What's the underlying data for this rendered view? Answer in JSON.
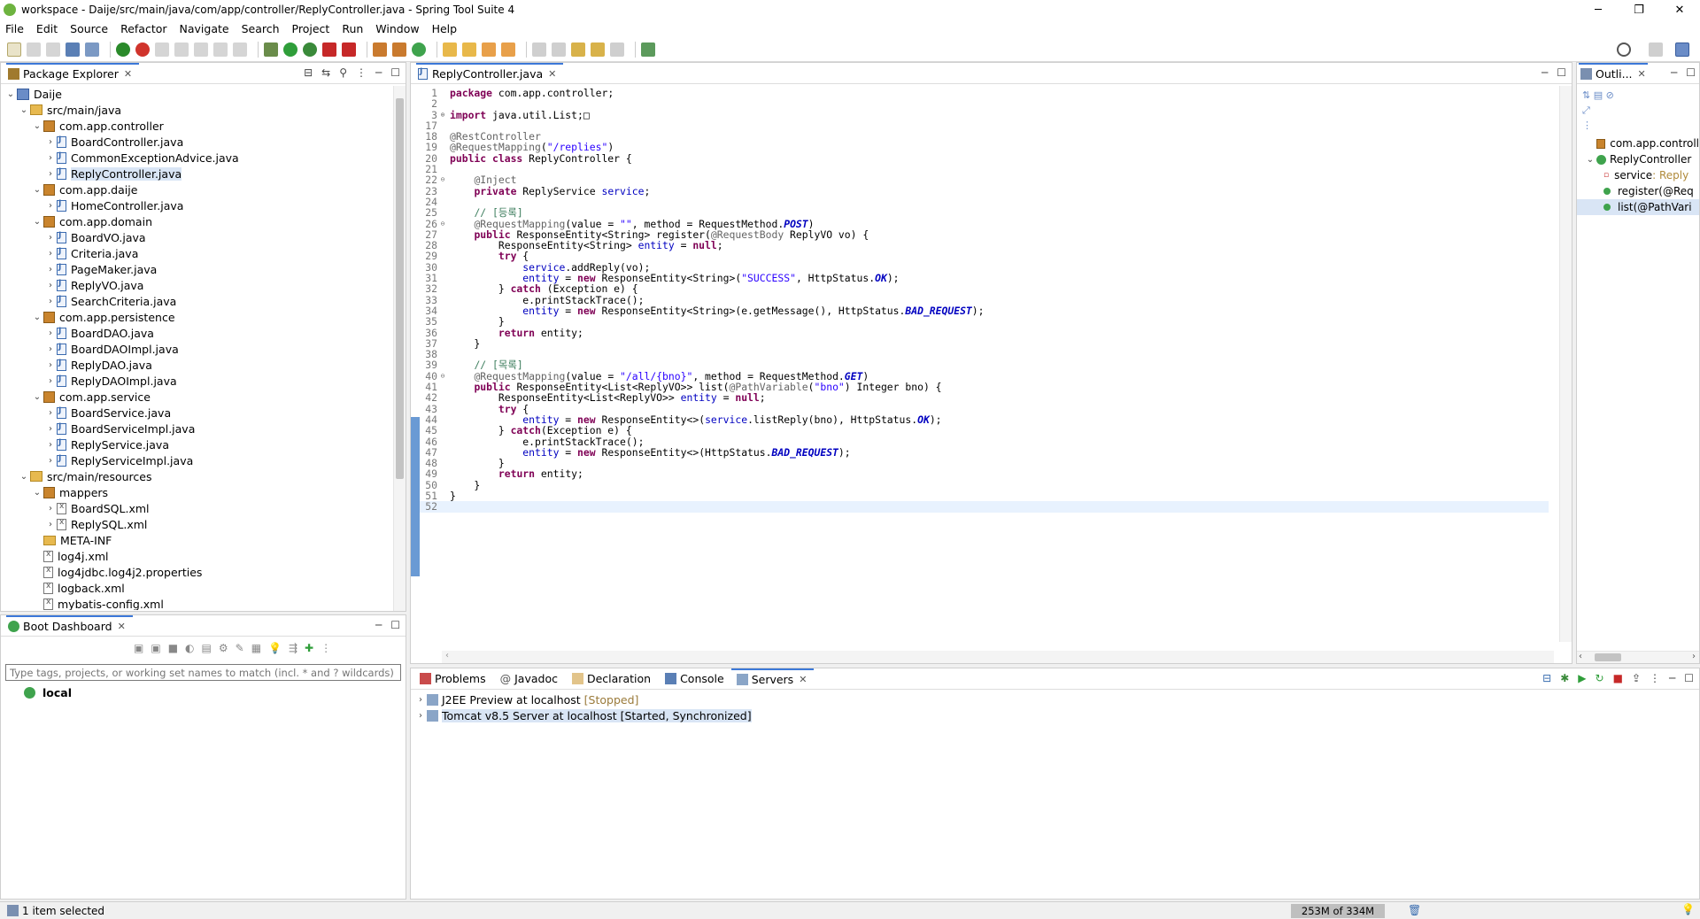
{
  "window": {
    "title": "workspace - Daije/src/main/java/com/app/controller/ReplyController.java - Spring Tool Suite 4"
  },
  "menu": [
    "File",
    "Edit",
    "Source",
    "Refactor",
    "Navigate",
    "Search",
    "Project",
    "Run",
    "Window",
    "Help"
  ],
  "package_explorer": {
    "tab_label": "Package Explorer",
    "tree": [
      {
        "label": "Daije",
        "depth": 0,
        "type": "project",
        "open": true
      },
      {
        "label": "src/main/java",
        "depth": 1,
        "type": "src",
        "open": true
      },
      {
        "label": "com.app.controller",
        "depth": 2,
        "type": "pkg",
        "open": true
      },
      {
        "label": "BoardController.java",
        "depth": 3,
        "type": "java"
      },
      {
        "label": "CommonExceptionAdvice.java",
        "depth": 3,
        "type": "java"
      },
      {
        "label": "ReplyController.java",
        "depth": 3,
        "type": "java",
        "selected": true
      },
      {
        "label": "com.app.daije",
        "depth": 2,
        "type": "pkg",
        "open": true
      },
      {
        "label": "HomeController.java",
        "depth": 3,
        "type": "java"
      },
      {
        "label": "com.app.domain",
        "depth": 2,
        "type": "pkg",
        "open": true
      },
      {
        "label": "BoardVO.java",
        "depth": 3,
        "type": "java"
      },
      {
        "label": "Criteria.java",
        "depth": 3,
        "type": "java"
      },
      {
        "label": "PageMaker.java",
        "depth": 3,
        "type": "java"
      },
      {
        "label": "ReplyVO.java",
        "depth": 3,
        "type": "java"
      },
      {
        "label": "SearchCriteria.java",
        "depth": 3,
        "type": "java"
      },
      {
        "label": "com.app.persistence",
        "depth": 2,
        "type": "pkg",
        "open": true
      },
      {
        "label": "BoardDAO.java",
        "depth": 3,
        "type": "java"
      },
      {
        "label": "BoardDAOImpl.java",
        "depth": 3,
        "type": "java"
      },
      {
        "label": "ReplyDAO.java",
        "depth": 3,
        "type": "java"
      },
      {
        "label": "ReplyDAOImpl.java",
        "depth": 3,
        "type": "java"
      },
      {
        "label": "com.app.service",
        "depth": 2,
        "type": "pkg",
        "open": true
      },
      {
        "label": "BoardService.java",
        "depth": 3,
        "type": "java"
      },
      {
        "label": "BoardServiceImpl.java",
        "depth": 3,
        "type": "java"
      },
      {
        "label": "ReplyService.java",
        "depth": 3,
        "type": "java"
      },
      {
        "label": "ReplyServiceImpl.java",
        "depth": 3,
        "type": "java"
      },
      {
        "label": "src/main/resources",
        "depth": 1,
        "type": "src",
        "open": true
      },
      {
        "label": "mappers",
        "depth": 2,
        "type": "pkg",
        "open": true
      },
      {
        "label": "BoardSQL.xml",
        "depth": 3,
        "type": "xml"
      },
      {
        "label": "ReplySQL.xml",
        "depth": 3,
        "type": "xml"
      },
      {
        "label": "META-INF",
        "depth": 2,
        "type": "folder",
        "leaf": true
      },
      {
        "label": "log4j.xml",
        "depth": 2,
        "type": "xml",
        "leaf": true
      },
      {
        "label": "log4jdbc.log4j2.properties",
        "depth": 2,
        "type": "xml",
        "leaf": true
      },
      {
        "label": "logback.xml",
        "depth": 2,
        "type": "xml",
        "leaf": true
      },
      {
        "label": "mybatis-config.xml",
        "depth": 2,
        "type": "xml",
        "leaf": true
      }
    ]
  },
  "boot_dashboard": {
    "tab_label": "Boot Dashboard",
    "filter_placeholder": "Type tags, projects, or working set names to match (incl. * and ? wildcards)",
    "item": "local"
  },
  "editor": {
    "tab_label": "ReplyController.java",
    "lines": [
      {
        "n": "1",
        "f": "",
        "html": "<span class='kw'>package</span> com.app.controller;"
      },
      {
        "n": "2",
        "f": "",
        "html": ""
      },
      {
        "n": "3",
        "f": "⊕",
        "html": "<span class='kw'>import</span> java.util.List;□"
      },
      {
        "n": "17",
        "f": "",
        "html": ""
      },
      {
        "n": "18",
        "f": "",
        "html": "<span class='an'>@RestController</span>"
      },
      {
        "n": "19",
        "f": "",
        "html": "<span class='an'>@RequestMapping</span>(<span class='st'>\"/replies\"</span>)"
      },
      {
        "n": "20",
        "f": "",
        "html": "<span class='kw'>public class</span> ReplyController {"
      },
      {
        "n": "21",
        "f": "",
        "html": ""
      },
      {
        "n": "22",
        "f": "⊖",
        "html": "    <span class='an'>@Inject</span>"
      },
      {
        "n": "23",
        "f": "",
        "html": "    <span class='kw'>private</span> ReplyService <span class='fd'>service</span>;"
      },
      {
        "n": "24",
        "f": "",
        "html": ""
      },
      {
        "n": "25",
        "f": "",
        "html": "    <span class='cm'>// [등록]</span>"
      },
      {
        "n": "26",
        "f": "⊖",
        "html": "    <span class='an'>@RequestMapping</span>(value = <span class='st'>\"\"</span>, method = RequestMethod.<span class='it'>POST</span>)"
      },
      {
        "n": "27",
        "f": "",
        "html": "    <span class='kw'>public</span> ResponseEntity&lt;String&gt; register(<span class='an'>@RequestBody</span> ReplyVO vo) {"
      },
      {
        "n": "28",
        "f": "",
        "html": "        ResponseEntity&lt;String&gt; <span class='fd'>entity</span> = <span class='kw'>null</span>;"
      },
      {
        "n": "29",
        "f": "",
        "html": "        <span class='kw'>try</span> {"
      },
      {
        "n": "30",
        "f": "",
        "html": "            <span class='fd'>service</span>.addReply(vo);"
      },
      {
        "n": "31",
        "f": "",
        "html": "            <span class='fd'>entity</span> = <span class='kw'>new</span> ResponseEntity&lt;String&gt;(<span class='st'>\"SUCCESS\"</span>, HttpStatus.<span class='it'>OK</span>);"
      },
      {
        "n": "32",
        "f": "",
        "html": "        } <span class='kw'>catch</span> (Exception e) {"
      },
      {
        "n": "33",
        "f": "",
        "html": "            e.printStackTrace();"
      },
      {
        "n": "34",
        "f": "",
        "html": "            <span class='fd'>entity</span> = <span class='kw'>new</span> ResponseEntity&lt;String&gt;(e.getMessage(), HttpStatus.<span class='it'>BAD_REQUEST</span>);"
      },
      {
        "n": "35",
        "f": "",
        "html": "        }"
      },
      {
        "n": "36",
        "f": "",
        "html": "        <span class='kw'>return</span> entity;"
      },
      {
        "n": "37",
        "f": "",
        "html": "    }"
      },
      {
        "n": "38",
        "f": "",
        "html": ""
      },
      {
        "n": "39",
        "f": "",
        "html": "    <span class='cm'>// [목록]</span>"
      },
      {
        "n": "40",
        "f": "⊖",
        "html": "    <span class='an'>@RequestMapping</span>(value = <span class='st'>\"/all/{bno}\"</span>, method = RequestMethod.<span class='it'>GET</span>)"
      },
      {
        "n": "41",
        "f": "",
        "html": "    <span class='kw'>public</span> ResponseEntity&lt;List&lt;ReplyVO&gt;&gt; list(<span class='an'>@PathVariable</span>(<span class='st'>\"bno\"</span>) Integer bno) {"
      },
      {
        "n": "42",
        "f": "",
        "html": "        ResponseEntity&lt;List&lt;ReplyVO&gt;&gt; <span class='fd'>entity</span> = <span class='kw'>null</span>;"
      },
      {
        "n": "43",
        "f": "",
        "html": "        <span class='kw'>try</span> {"
      },
      {
        "n": "44",
        "f": "",
        "html": "            <span class='fd'>entity</span> = <span class='kw'>new</span> ResponseEntity&lt;&gt;(<span class='fd'>service</span>.listReply(bno), HttpStatus.<span class='it'>OK</span>);"
      },
      {
        "n": "45",
        "f": "",
        "html": "        } <span class='kw'>catch</span>(Exception e) {"
      },
      {
        "n": "46",
        "f": "",
        "html": "            e.printStackTrace();"
      },
      {
        "n": "47",
        "f": "",
        "html": "            <span class='fd'>entity</span> = <span class='kw'>new</span> ResponseEntity&lt;&gt;(HttpStatus.<span class='it'>BAD_REQUEST</span>);"
      },
      {
        "n": "48",
        "f": "",
        "html": "        }"
      },
      {
        "n": "49",
        "f": "",
        "html": "        <span class='kw'>return</span> entity;"
      },
      {
        "n": "50",
        "f": "",
        "html": "    }"
      },
      {
        "n": "51",
        "f": "",
        "html": "}"
      },
      {
        "n": "52",
        "f": "",
        "html": "",
        "current": true
      }
    ]
  },
  "outline": {
    "tab_label": "Outli...",
    "items": [
      {
        "label": "com.app.controll",
        "depth": 0,
        "kind": "pkg"
      },
      {
        "label": "ReplyController",
        "depth": 0,
        "kind": "class",
        "open": true
      },
      {
        "label": "service",
        "suffix": " : Reply",
        "depth": 1,
        "kind": "field"
      },
      {
        "label": "register(@Req",
        "depth": 1,
        "kind": "method"
      },
      {
        "label": "list(@PathVari",
        "depth": 1,
        "kind": "method",
        "selected": true
      }
    ]
  },
  "bottom": {
    "tabs": [
      "Problems",
      "Javadoc",
      "Declaration",
      "Console",
      "Servers"
    ],
    "active_tab": "Servers",
    "servers": [
      {
        "name": "J2EE Preview at localhost",
        "state": "[Stopped]",
        "selected": false
      },
      {
        "name": "Tomcat v8.5 Server at localhost",
        "state": "[Started, Synchronized]",
        "selected": true
      }
    ]
  },
  "status": {
    "left": "1 item selected",
    "heap": "253M of 334M"
  },
  "colors": {
    "accent": "#3c78d8",
    "selection": "#d9e5f5",
    "spring": "#6db33f"
  }
}
